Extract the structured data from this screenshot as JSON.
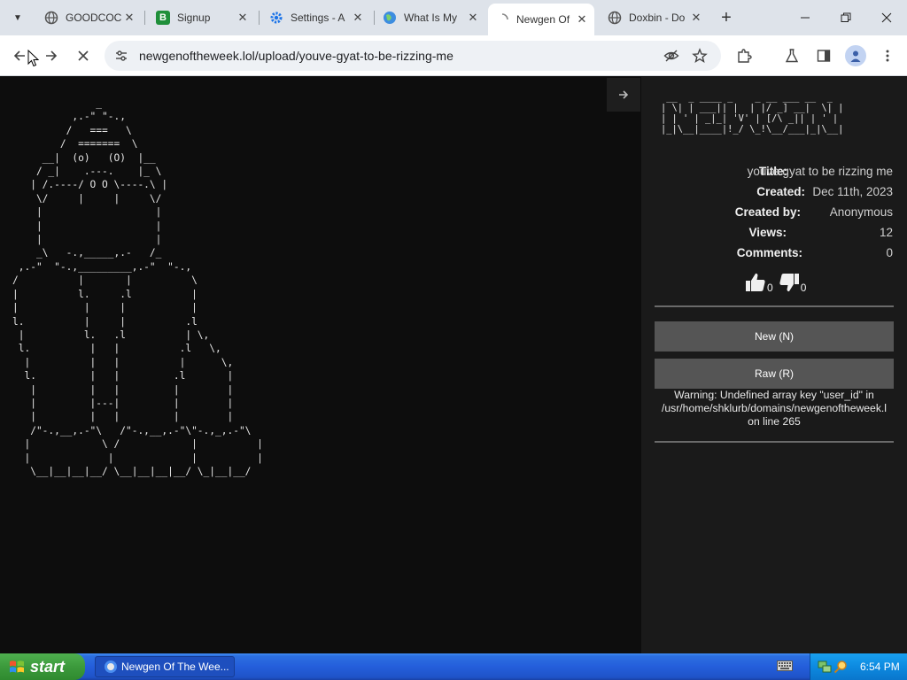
{
  "browser": {
    "tabs": [
      {
        "title": "GOODCOCK",
        "favicon": "globe-icon",
        "active": false
      },
      {
        "title": "Signup",
        "favicon": "b-logo-icon",
        "active": false
      },
      {
        "title": "Settings - A",
        "favicon": "gear-icon",
        "active": false
      },
      {
        "title": "What Is My",
        "favicon": "globe-color-icon",
        "active": false
      },
      {
        "title": "Newgen Of",
        "favicon": "loading-icon",
        "active": true
      },
      {
        "title": "Doxbin - Do",
        "favicon": "globe-icon",
        "active": false
      }
    ],
    "new_tab_label": "+",
    "url": "newgenoftheweek.lol/upload/youve-gyat-to-be-rizzing-me"
  },
  "page": {
    "ascii_art": "              _\n          ,.-\" \"-.,\n         /   ===   \\\n        /  =======  \\\n     __|  (o)   (O)  |__\n    / _|    .---.    |_ \\\n   | /.----/ O O \\----.\\ |\n    \\/     |     |     \\/\n    |                   |\n    |                   |\n    |                   |\n    _\\   -.,_____,.-   /_\n ,.-\"  \"-.,_________,.-\"  \"-.,\n/          |       |          \\\n|          l.     .l          |\n|           |     |           |\nl.          |     |          .l\n |          l.   .l          | \\,\n l.          |   |          .l   \\,\n  |          |   |          |      \\,\n  l.         |   |         .l       |\n   |         |   |         |        |\n   |         |---|         |        |\n   |         |   |         |        |\n   /\"-.,__,.-\"\\   /\"-.,__,.-\"\\\"-.,_,.-\"\\\n  |            \\ /            |          |\n  |             |             |          |\n   \\__|__|__|__/ \\__|__|__|__/ \\_|__|__/",
    "logo_ascii": " __  _ ____ _    _ __ ___ __  _\n| \\| | ___|| |  | |/ _] __|  \\| |\n| | ' | _|_| 'V' | [/\\ _|| | ' |\n|_|\\__|____|!_/ \\_!\\__/___|_|\\__|",
    "collapse_icon": "arrow-right-icon",
    "meta": [
      {
        "label": "Title:",
        "value": "youve gyat to be rizzing me"
      },
      {
        "label": "Created:",
        "value": "Dec 11th, 2023"
      },
      {
        "label": "Created by:",
        "value": "Anonymous"
      },
      {
        "label": "Views:",
        "value": "12"
      },
      {
        "label": "Comments:",
        "value": "0"
      }
    ],
    "votes": {
      "up": "0",
      "down": "0"
    },
    "buttons": {
      "new": "New (N)",
      "raw": "Raw (R)"
    },
    "warning": {
      "line1": "Warning: Undefined array key \"user_id\" in",
      "line2": "/usr/home/shklurb/domains/newgenoftheweek.l",
      "line3": "on line 265"
    }
  },
  "taskbar": {
    "start_label": "start",
    "task_item": "Newgen Of The Wee...",
    "clock": "6:54 PM"
  }
}
